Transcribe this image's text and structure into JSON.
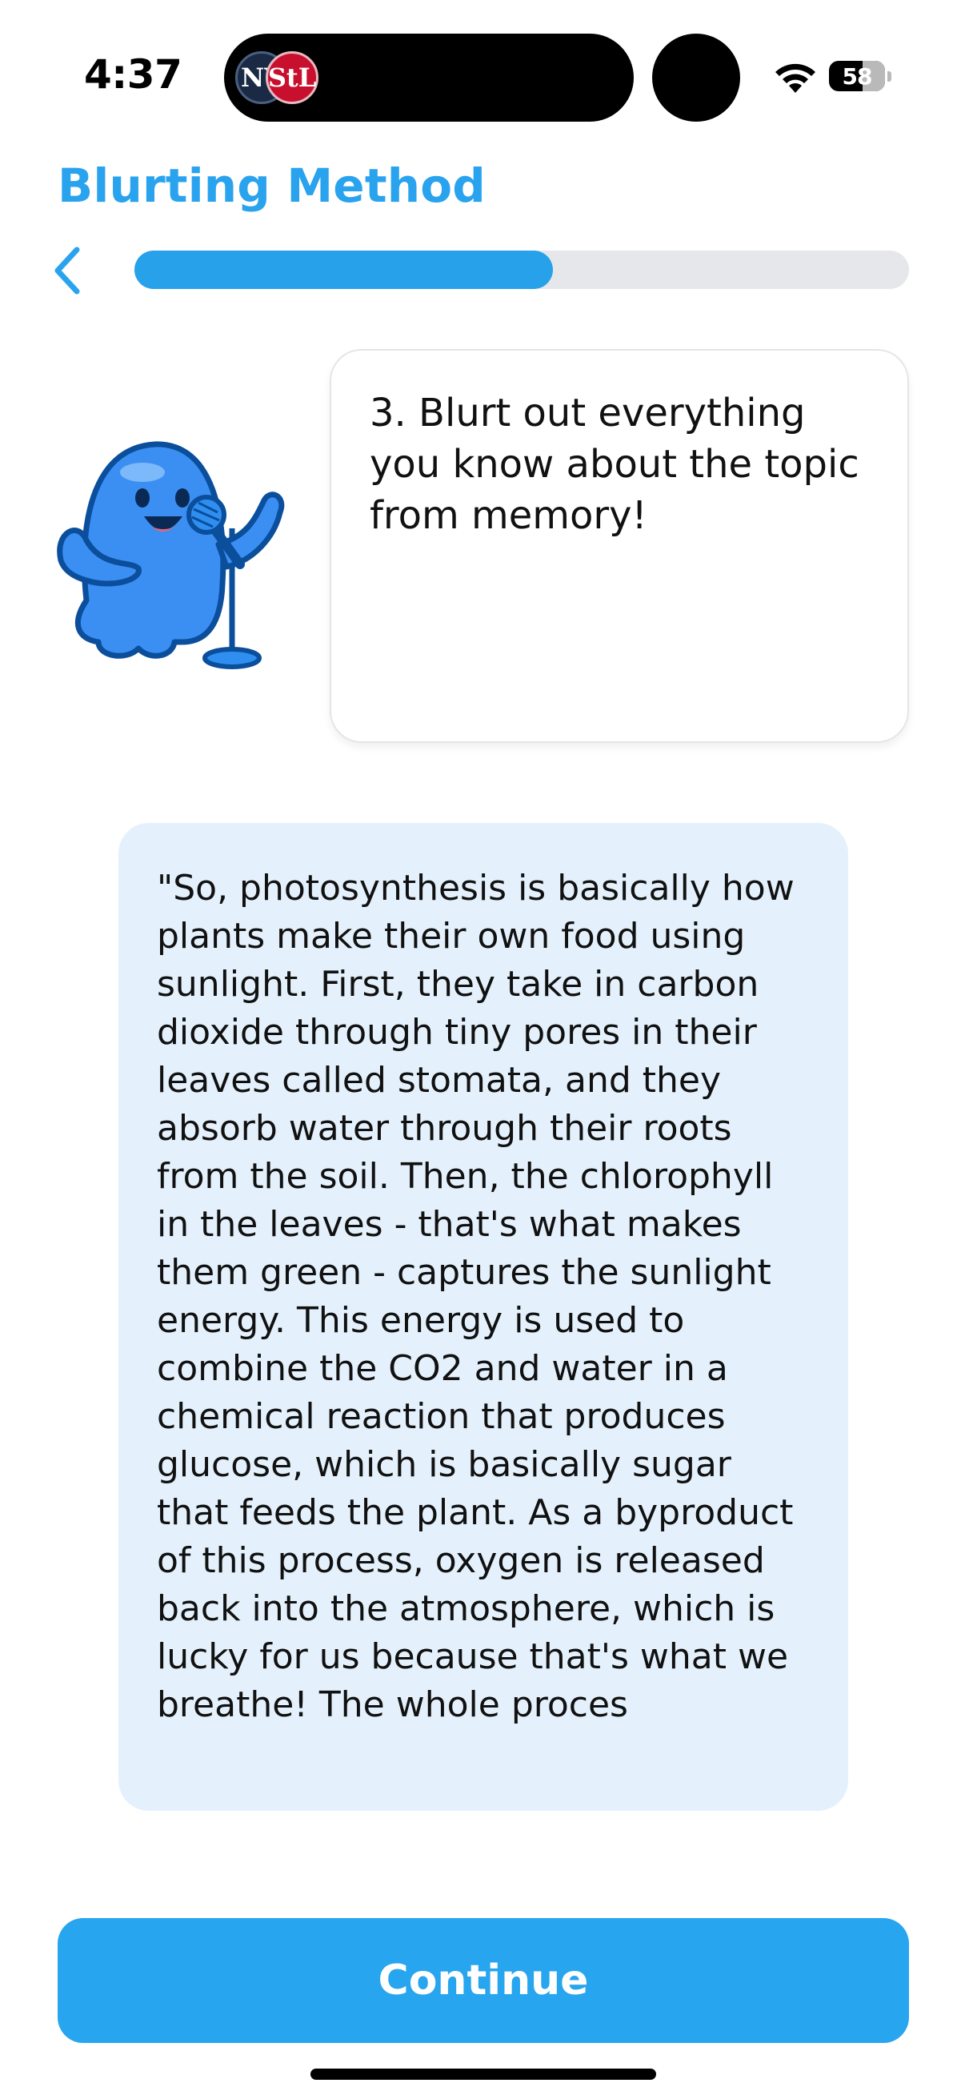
{
  "status_bar": {
    "time": "4:37",
    "battery_level": "58",
    "live_activity": {
      "team_left_monogram": "NY",
      "team_right_monogram": "StL"
    }
  },
  "header": {
    "title": "Blurting Method",
    "progress_fraction": 0.54,
    "accent_color": "#2AA3EE"
  },
  "prompt_bubble": {
    "text": "3. Blurt out everything you know about the topic from memory!"
  },
  "mascot": {
    "icon": "blue-blob-with-microphone-icon"
  },
  "response": {
    "text": "\"So, photosynthesis is basically how plants make their own food using sunlight. First, they take in carbon dioxide through tiny pores in their leaves called stomata, and they absorb water through their roots from the soil. Then, the chlorophyll in the leaves - that's what makes them green - captures the sunlight energy. This energy is used to combine the CO2 and water in a chemical reaction that produces glucose, which is basically sugar that feeds the plant. As a byproduct of this process, oxygen is released back into the atmosphere, which is lucky for us because that's what we breathe! The whole proces"
  },
  "footer": {
    "continue_label": "Continue",
    "button_color": "#27A5EE"
  }
}
